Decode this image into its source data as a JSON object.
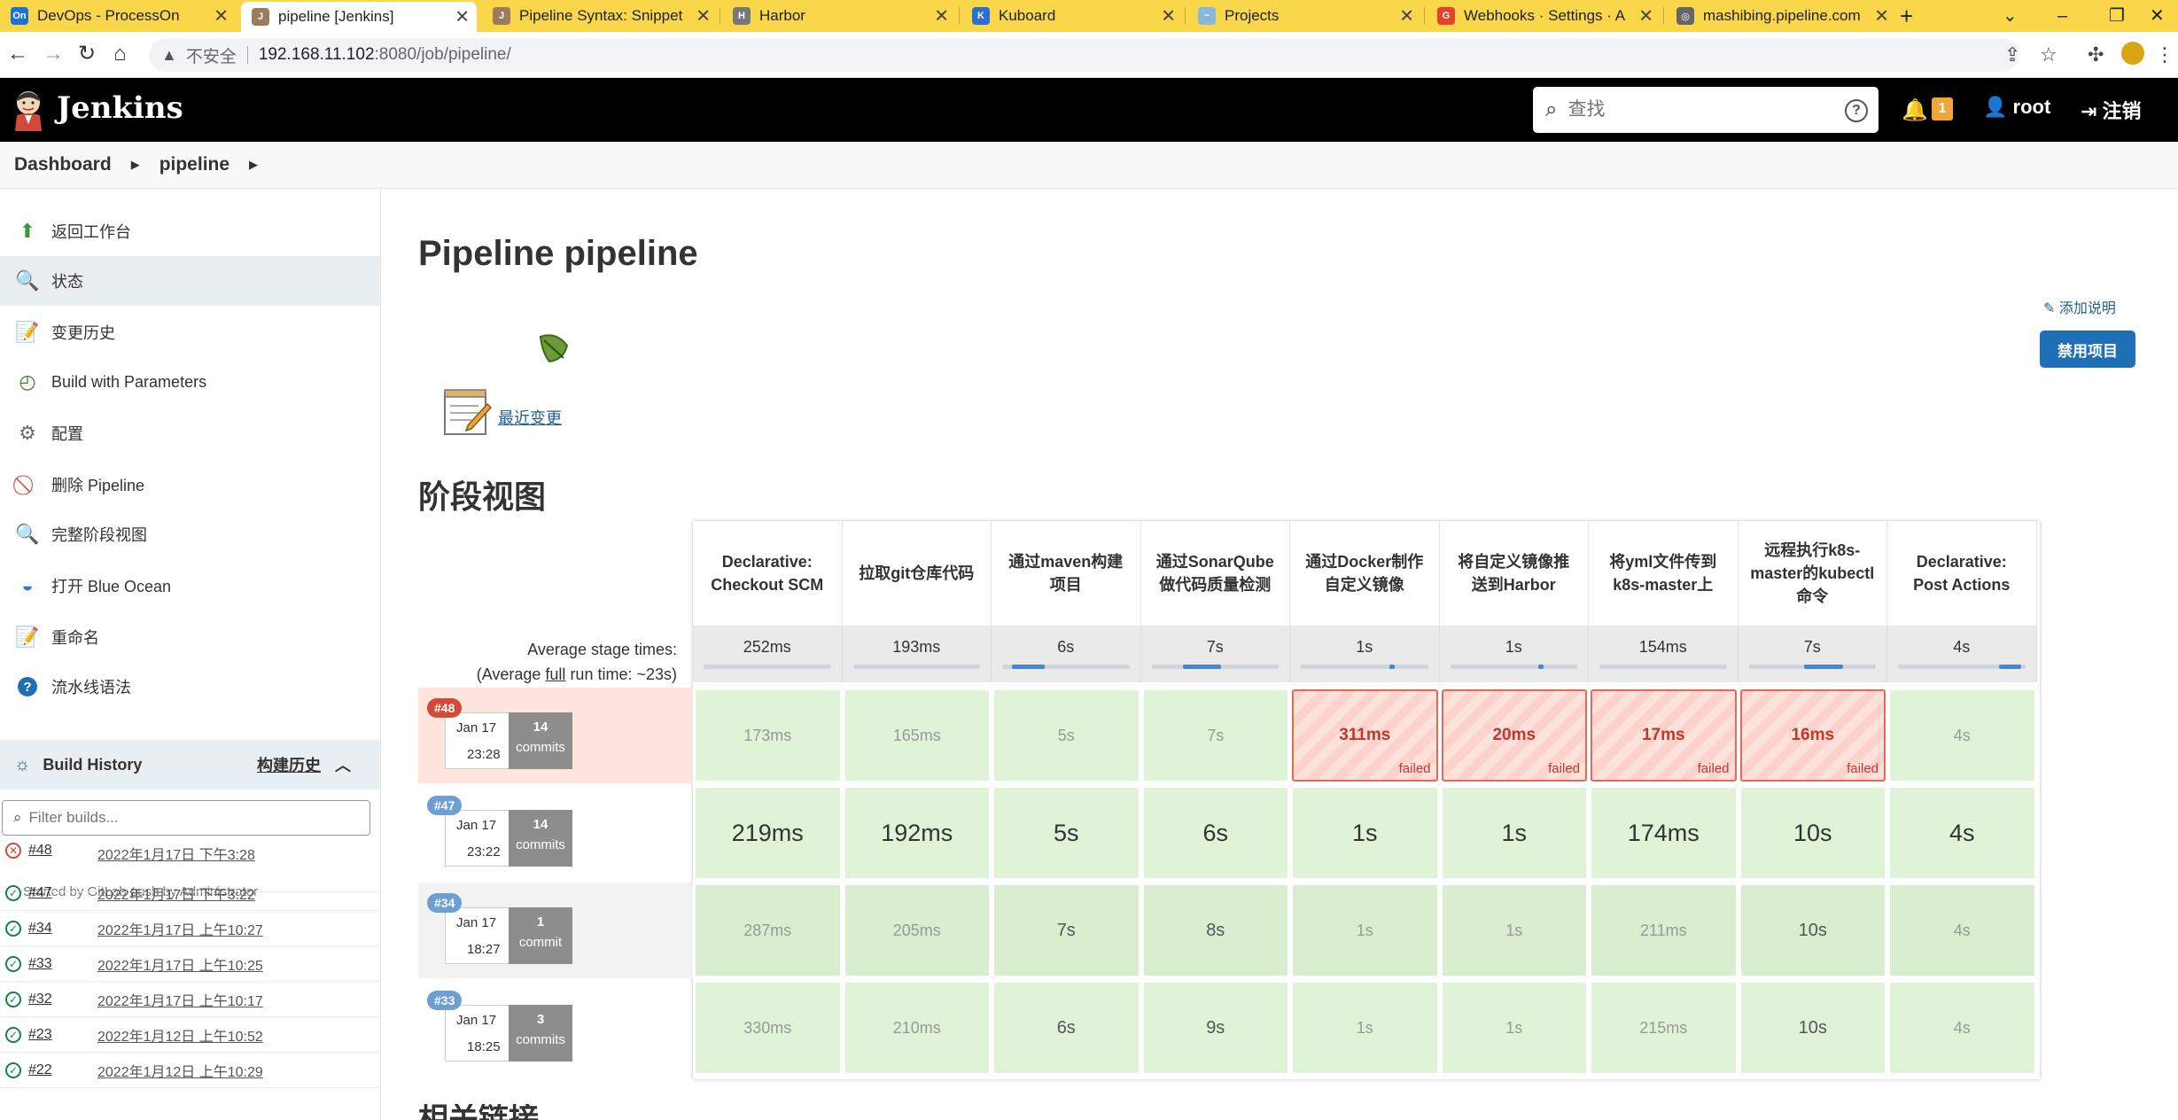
{
  "browser": {
    "tabs": [
      {
        "title": "DevOps - ProcessOn",
        "icon_text": "On",
        "icon_color": "#1f6fd8",
        "active": false
      },
      {
        "title": "pipeline [Jenkins]",
        "icon_text": "J",
        "icon_color": "#9c7a5b",
        "active": true
      },
      {
        "title": "Pipeline Syntax: Snippet",
        "icon_text": "J",
        "icon_color": "#9c7a5b",
        "active": false
      },
      {
        "title": "Harbor",
        "icon_text": "H",
        "icon_color": "#777777",
        "active": false
      },
      {
        "title": "Kuboard",
        "icon_text": "K",
        "icon_color": "#2b6cd6",
        "active": false
      },
      {
        "title": "Projects",
        "icon_text": "~",
        "icon_color": "#8bb8d8",
        "active": false
      },
      {
        "title": "Webhooks · Settings · A",
        "icon_text": "G",
        "icon_color": "#e24329",
        "active": false
      },
      {
        "title": "mashibing.pipeline.com",
        "icon_text": "◎",
        "icon_color": "#666666",
        "active": false
      }
    ],
    "url_insecure": "不安全",
    "url_host": "192.168.11.102",
    "url_path": ":8080/job/pipeline/"
  },
  "header": {
    "title": "Jenkins",
    "search_placeholder": "查找",
    "notif_count": "1",
    "user": "root",
    "logout": "注销"
  },
  "breadcrumb": [
    "Dashboard",
    "pipeline"
  ],
  "sidebar": {
    "items": [
      {
        "label": "返回工作台",
        "icon": "up-arrow-icon",
        "glyph": "⬆",
        "color": "#3a9a3a"
      },
      {
        "label": "状态",
        "icon": "search-icon",
        "glyph": "🔍",
        "color": "#6a7a8a"
      },
      {
        "label": "变更历史",
        "icon": "notepad-icon",
        "glyph": "📝",
        "color": "#8a6a3a"
      },
      {
        "label": "Build with Parameters",
        "icon": "clock-play-icon",
        "glyph": "◴",
        "color": "#3a7a3a"
      },
      {
        "label": "配置",
        "icon": "gear-icon",
        "glyph": "⚙",
        "color": "#6a6a6a"
      },
      {
        "label": "删除 Pipeline",
        "icon": "no-entry-icon",
        "glyph": "⃠",
        "color": "#d24939"
      },
      {
        "label": "完整阶段视图",
        "icon": "search-icon",
        "glyph": "🔍",
        "color": "#6a7a8a"
      },
      {
        "label": "打开 Blue Ocean",
        "icon": "blue-ocean-icon",
        "glyph": "◒",
        "color": "#2a7ac8"
      },
      {
        "label": "重命名",
        "icon": "notepad-icon",
        "glyph": "📝",
        "color": "#8a6a3a"
      },
      {
        "label": "流水线语法",
        "icon": "help-icon",
        "glyph": "?",
        "color": "#1e6fb6"
      }
    ],
    "build_history_title": "Build History",
    "build_history_trend": "构建历史",
    "filter_placeholder": "Filter builds...",
    "builds": [
      {
        "num": "#48",
        "date": "2022年1月17日 下午3:28",
        "status": "fail"
      },
      {
        "num": "#47",
        "date": "2022年1月17日 下午3:22",
        "status": "ok"
      },
      {
        "num": "#34",
        "date": "2022年1月17日 上午10:27",
        "status": "ok"
      },
      {
        "num": "#33",
        "date": "2022年1月17日 上午10:25",
        "status": "ok"
      },
      {
        "num": "#32",
        "date": "2022年1月17日 上午10:17",
        "status": "ok"
      },
      {
        "num": "#23",
        "date": "2022年1月12日 上午10:52",
        "status": "ok"
      },
      {
        "num": "#22",
        "date": "2022年1月12日 上午10:29",
        "status": "ok"
      }
    ],
    "build48_cause": "Started by GitLab push by Administrator"
  },
  "main": {
    "title": "Pipeline pipeline",
    "add_description": "添加说明",
    "disable_button": "禁用项目",
    "recent_changes": "最近变更",
    "stage_view_title": "阶段视图",
    "next_section_title": "相关链接",
    "avg_label_1": "Average stage times:",
    "avg_label_2_pre": "(Average ",
    "avg_label_2_full": "full",
    "avg_label_2_post": " run time: ~23s)"
  },
  "stage_view": {
    "stages": [
      {
        "name": "Declarative: Checkout SCM",
        "avg": "252ms",
        "avg_frac": 0.0
      },
      {
        "name": "拉取git仓库代码",
        "avg": "193ms",
        "avg_frac": 0.0
      },
      {
        "name": "通过maven构建项目",
        "avg": "6s",
        "avg_frac": 0.26
      },
      {
        "name": "通过SonarQube做代码质量检测",
        "avg": "7s",
        "avg_frac": 0.3
      },
      {
        "name": "通过Docker制作自定义镜像",
        "avg": "1s",
        "avg_frac": 0.04
      },
      {
        "name": "将自定义镜像推送到Harbor",
        "avg": "1s",
        "avg_frac": 0.04
      },
      {
        "name": "将yml文件传到k8s-master上",
        "avg": "154ms",
        "avg_frac": 0.0
      },
      {
        "name": "远程执行k8s-master的kubectl命令",
        "avg": "7s",
        "avg_frac": 0.3
      },
      {
        "name": "Declarative: Post Actions",
        "avg": "4s",
        "avg_frac": 0.17
      }
    ],
    "runs": [
      {
        "badge": "#48",
        "badge_color": "red",
        "date": "Jan 17",
        "time": "23:28",
        "commits": "14",
        "commits_word": "commits",
        "cells": [
          "173ms",
          "165ms",
          "5s",
          "7s",
          "311ms",
          "20ms",
          "17ms",
          "16ms",
          "4s"
        ],
        "failed": [
          false,
          false,
          false,
          false,
          true,
          true,
          true,
          true,
          false
        ],
        "failed_label": "failed"
      },
      {
        "badge": "#47",
        "badge_color": "blue",
        "date": "Jan 17",
        "time": "23:22",
        "commits": "14",
        "commits_word": "commits",
        "cells": [
          "219ms",
          "192ms",
          "5s",
          "6s",
          "1s",
          "1s",
          "174ms",
          "10s",
          "4s"
        ]
      },
      {
        "badge": "#34",
        "badge_color": "blue",
        "date": "Jan 17",
        "time": "18:27",
        "commits": "1",
        "commits_word": "commit",
        "cells": [
          "287ms",
          "205ms",
          "7s",
          "8s",
          "1s",
          "1s",
          "211ms",
          "10s",
          "4s"
        ]
      },
      {
        "badge": "#33",
        "badge_color": "blue",
        "date": "Jan 17",
        "time": "18:25",
        "commits": "3",
        "commits_word": "commits",
        "cells": [
          "330ms",
          "210ms",
          "6s",
          "9s",
          "1s",
          "1s",
          "215ms",
          "10s",
          "4s"
        ]
      }
    ]
  }
}
